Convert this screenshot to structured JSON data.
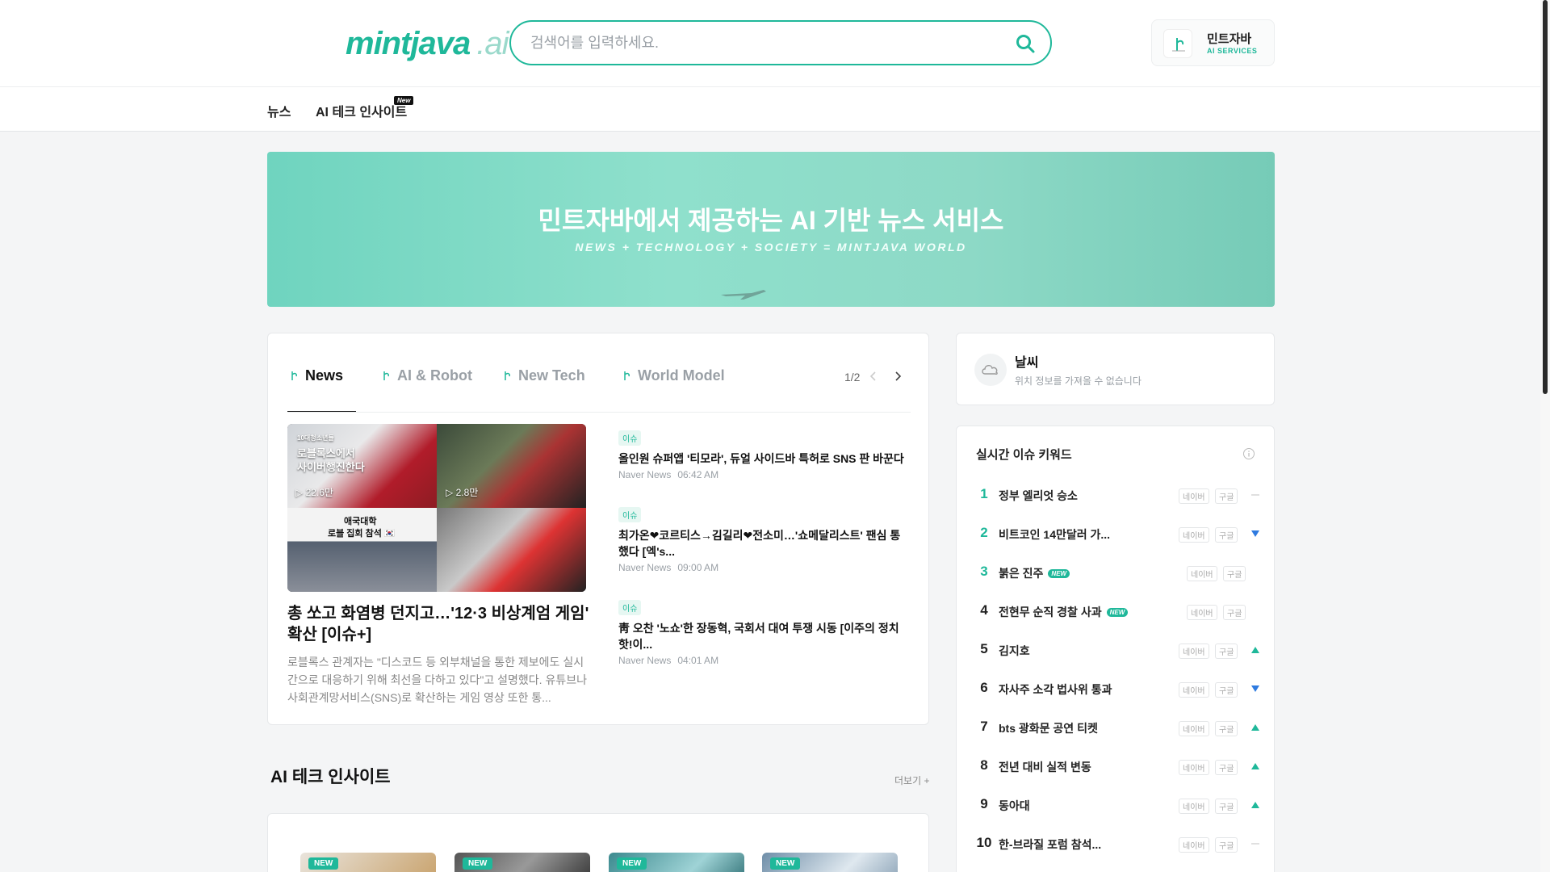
{
  "header": {
    "logo_main": "mintjava",
    "logo_suffix": ".ai",
    "search_placeholder": "검색어를 입력하세요.",
    "services_title": "민트자바",
    "services_sub": "AI SERVICES"
  },
  "nav": {
    "items": [
      {
        "label": "뉴스"
      },
      {
        "label": "AI 테크 인사이트",
        "badge": "New"
      }
    ]
  },
  "hero": {
    "title": "민트자바에서 제공하는 AI 기반 뉴스 서비스",
    "subtitle": "NEWS + TECHNOLOGY + SOCIETY = MINTJAVA WORLD"
  },
  "news_tabs": {
    "tabs": [
      {
        "label": "News"
      },
      {
        "label": "AI & Robot"
      },
      {
        "label": "New Tech"
      },
      {
        "label": "World Model"
      }
    ],
    "pager": "1/2"
  },
  "feature": {
    "img_caption_small": "10대청소년들",
    "img_caption_line1": "로블록스에서",
    "img_caption_line2": "사이버행진한다",
    "views_1": "22.6만",
    "views_2": "2.8만",
    "img_caption_bottom1": "애국대학",
    "img_caption_bottom2": "로블 집회 참석 🇰🇷",
    "title": "총 쏘고 화염병 던지고…'12·3 비상계엄 게임' 확산 [이슈+]",
    "desc": "로블록스 관계자는 \"디스코드 등 외부채널을 통한 제보에도 실시간으로 대응하기 위해 최선을 다하고 있다\"고 설명했다. 유튜브나 사회관계망서비스(SNS)로 확산하는 게임 영상 또한 통..."
  },
  "news_list": [
    {
      "tag": "이슈",
      "title": "올인원 슈퍼앱 '티모라', 듀얼 사이드바 특허로 SNS 판 바꾼다",
      "source": "Naver News",
      "time": "06:42 AM"
    },
    {
      "tag": "이슈",
      "title": "최가온❤코르티스→김길리❤전소미…'쇼메달리스트' 팬심 통했다 [엑's...",
      "source": "Naver News",
      "time": "09:00 AM"
    },
    {
      "tag": "이슈",
      "title": "靑 오찬 '노쇼'한 장동혁, 국회서 대여 투쟁 시동 [이주의 정치핫!이...",
      "source": "Naver News",
      "time": "04:01 AM"
    }
  ],
  "insights": {
    "title": "AI 테크 인사이트",
    "more": "더보기 +",
    "cards": [
      {
        "badge": "NEW"
      },
      {
        "badge": "NEW"
      },
      {
        "badge": "NEW"
      },
      {
        "badge": "NEW"
      }
    ]
  },
  "weather": {
    "title": "날씨",
    "message": "위치 정보를 가져올 수 없습니다"
  },
  "keywords": {
    "title": "실시간 이슈 키워드",
    "chip_naver": "네이버",
    "chip_google": "구글",
    "items": [
      {
        "rank": "1",
        "text": "정부 엘리엇 승소",
        "new": false,
        "trend": "same"
      },
      {
        "rank": "2",
        "text": "비트코인 14만달러 가...",
        "new": false,
        "trend": "down"
      },
      {
        "rank": "3",
        "text": "붉은 진주",
        "new": true,
        "trend": "none"
      },
      {
        "rank": "4",
        "text": "전현무 순직 경찰 사과",
        "new": true,
        "trend": "none"
      },
      {
        "rank": "5",
        "text": "김지호",
        "new": false,
        "trend": "up"
      },
      {
        "rank": "6",
        "text": "자사주 소각 법사위 통과",
        "new": false,
        "trend": "down"
      },
      {
        "rank": "7",
        "text": "bts 광화문 공연 티켓",
        "new": false,
        "trend": "up"
      },
      {
        "rank": "8",
        "text": "전년 대비 실적 변동",
        "new": false,
        "trend": "up"
      },
      {
        "rank": "9",
        "text": "동아대",
        "new": false,
        "trend": "up"
      },
      {
        "rank": "10",
        "text": "한-브라질 포럼 참석...",
        "new": false,
        "trend": "same"
      }
    ],
    "new_label": "NEW"
  },
  "colors": {
    "accent": "#1fb89a",
    "trend_down": "#2f7be0",
    "trend_up": "#1fb89a"
  }
}
